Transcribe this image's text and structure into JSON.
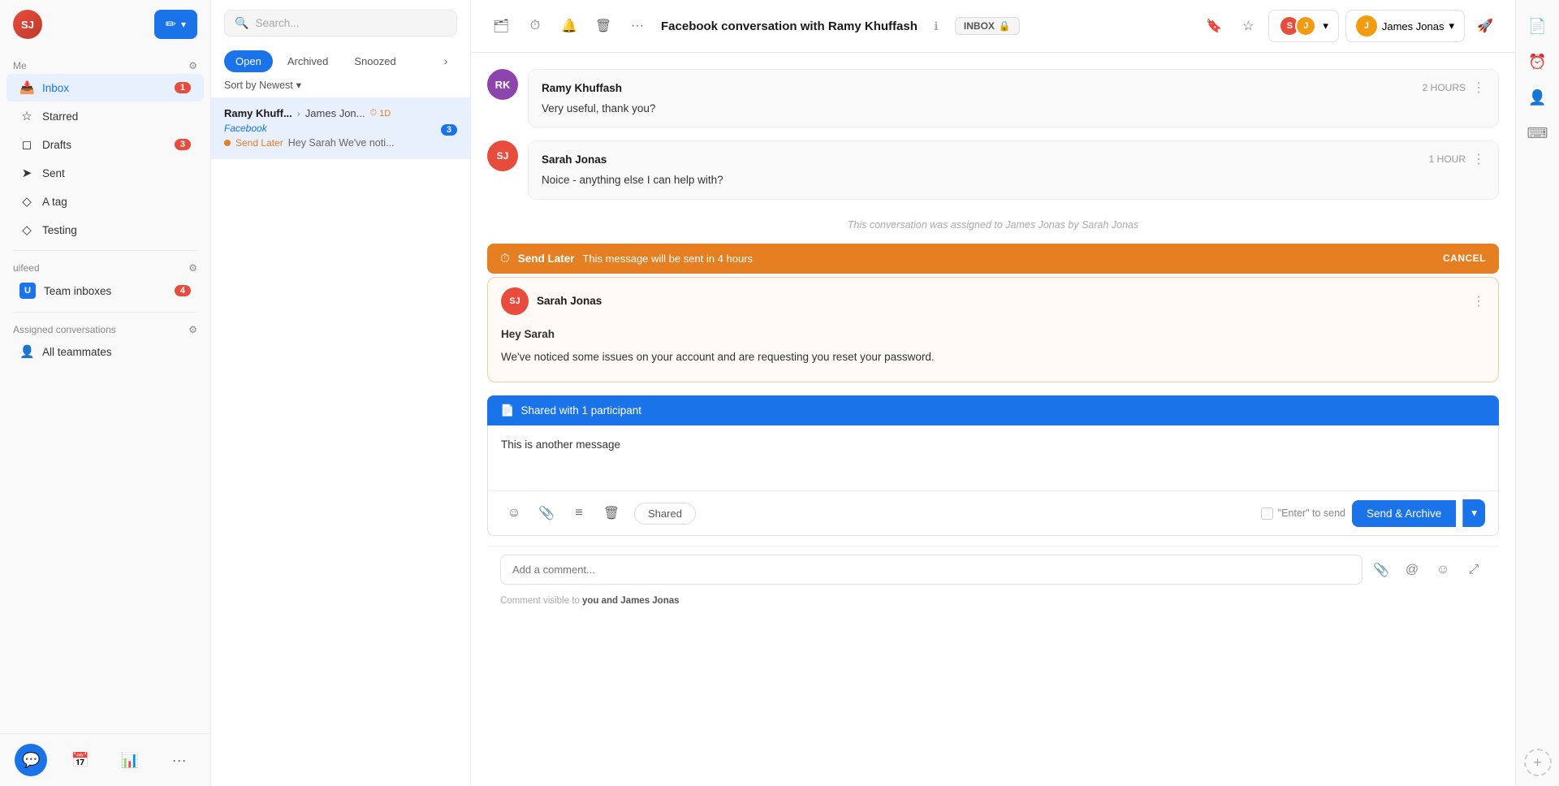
{
  "sidebar": {
    "user_initials": "SJ",
    "compose_icon": "✏",
    "me_section": "Me",
    "settings_icon": "⚙",
    "nav_items": [
      {
        "id": "inbox",
        "icon": "📥",
        "label": "Inbox",
        "badge": "1",
        "active": true
      },
      {
        "id": "starred",
        "icon": "☆",
        "label": "Starred",
        "badge": null
      },
      {
        "id": "drafts",
        "icon": "◻",
        "label": "Drafts",
        "badge": "3"
      },
      {
        "id": "sent",
        "icon": "➤",
        "label": "Sent",
        "badge": null
      },
      {
        "id": "a-tag",
        "icon": "◇",
        "label": "A tag",
        "badge": null
      },
      {
        "id": "testing",
        "icon": "◇",
        "label": "Testing",
        "badge": null
      }
    ],
    "team_section": "uifeed",
    "team_items": [
      {
        "id": "team-inboxes",
        "icon": "U",
        "label": "Team inboxes",
        "badge": "4"
      }
    ],
    "assigned_section": "Assigned conversations",
    "assigned_items": [
      {
        "id": "all-teammates",
        "icon": "👤",
        "label": "All teammates"
      }
    ],
    "bottom_items": [
      {
        "id": "chat",
        "icon": "💬",
        "active": true
      },
      {
        "id": "calendar",
        "icon": "📅",
        "active": false
      },
      {
        "id": "stats",
        "icon": "📊",
        "active": false
      },
      {
        "id": "more",
        "icon": "···",
        "active": false
      }
    ]
  },
  "conv_list": {
    "search_placeholder": "Search...",
    "tabs": [
      {
        "id": "open",
        "label": "Open",
        "active": true
      },
      {
        "id": "archived",
        "label": "Archived",
        "active": false
      },
      {
        "id": "snoozed",
        "label": "Snoozed",
        "active": false
      }
    ],
    "sort_label": "Sort by Newest",
    "conversations": [
      {
        "id": "conv-1",
        "from": "Ramy Khuff...",
        "arrow": "›",
        "to": "James Jon...",
        "timer": "1D",
        "channel": "Facebook",
        "channel_badge": "3",
        "preview_icon": "send-later",
        "preview_label": "Send Later",
        "preview_text": "Hey Sarah We've noti...",
        "active": true
      }
    ]
  },
  "main": {
    "toolbar": {
      "archive_icon": "🗂",
      "timer_icon": "⏱",
      "bell_icon": "🔔",
      "trash_icon": "🗑",
      "more_icon": "···"
    },
    "title": "Facebook conversation with Ramy Khuffash",
    "info_icon": "ℹ",
    "inbox_label": "INBOX",
    "lock_icon": "🔒",
    "star_icon": "☆",
    "pin_icon": "🔖",
    "contact_icon": "👤",
    "agent_selector": {
      "agent1_initials": "S",
      "agent2_initials": "J"
    },
    "agent_name": "James Jonas",
    "messages": [
      {
        "id": "msg-1",
        "avatar_initials": "RK",
        "avatar_class": "ramy",
        "sender": "Ramy Khuffash",
        "time": "2 HOURS",
        "text": "Very useful, thank you?"
      },
      {
        "id": "msg-2",
        "avatar_initials": "SJ",
        "avatar_class": "sj",
        "sender": "Sarah Jonas",
        "time": "1 HOUR",
        "text": "Noice - anything else I can help with?"
      }
    ],
    "assignment_note": "This conversation was assigned to James Jonas by Sarah Jonas",
    "send_later_bar": {
      "icon": "⏱",
      "label": "Send Later",
      "desc": "This message will be sent in 4 hours",
      "cancel_label": "CANCEL"
    },
    "send_later_msg": {
      "sender": "Sarah Jonas",
      "avatar_initials": "SJ",
      "avatar_class": "sj",
      "greeting": "Hey Sarah",
      "body": "We've noticed some issues on your account and are requesting you reset your password."
    },
    "compose": {
      "shared_banner": "Shared with 1 participant",
      "shared_icon": "📄",
      "editor_text": "This is another message",
      "shared_pill_label": "Shared",
      "enter_to_send_label": "\"Enter\" to send",
      "send_archive_label": "Send & Archive",
      "send_archive_dropdown_icon": "▾"
    },
    "comment": {
      "placeholder": "Add a comment...",
      "attachment_icon": "📎",
      "mention_icon": "@",
      "emoji_icon": "☺",
      "expand_icon": "⤢",
      "note": "Comment visible to",
      "note_users": "you and James Jonas"
    }
  },
  "right_panel": {
    "buttons": [
      {
        "id": "article",
        "icon": "📄"
      },
      {
        "id": "clock",
        "icon": "⏰"
      },
      {
        "id": "contact",
        "icon": "👤"
      },
      {
        "id": "keyboard",
        "icon": "⌨"
      }
    ],
    "add_label": "+"
  }
}
